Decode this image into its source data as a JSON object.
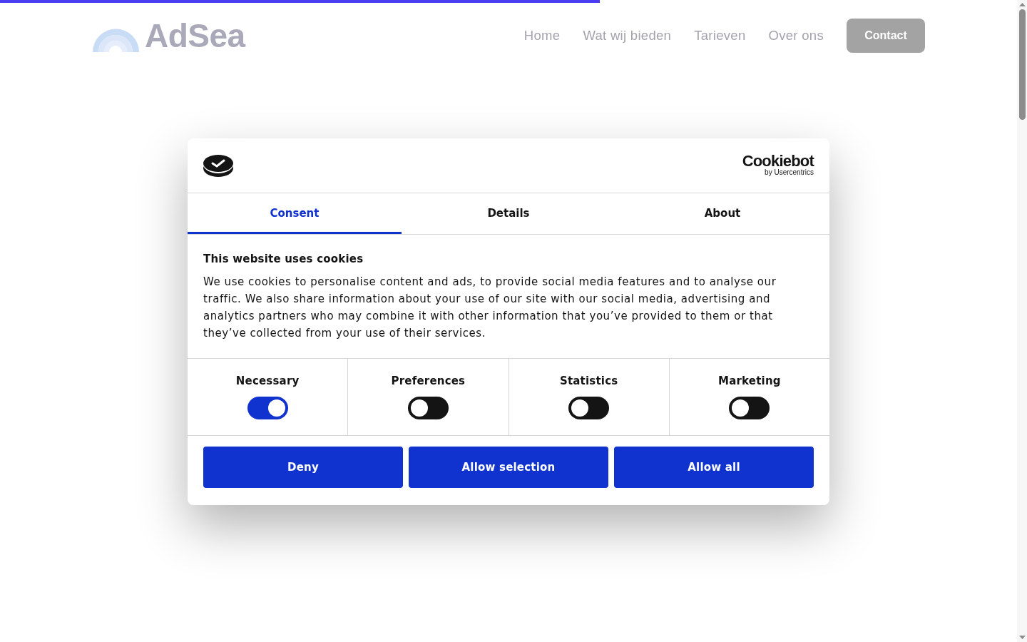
{
  "progress_bar": {
    "level": 0.59
  },
  "header": {
    "logo": {
      "text": "AdSea"
    },
    "nav": [
      "Home",
      "Wat wij bieden",
      "Tarieven",
      "Over ons"
    ],
    "cta": "Contact"
  },
  "dialog": {
    "brand": {
      "name": "Cookiebot",
      "tagline": "by Usercentrics"
    },
    "tabs": [
      {
        "label": "Consent",
        "selected": true
      },
      {
        "label": "Details",
        "selected": false
      },
      {
        "label": "About",
        "selected": false
      }
    ],
    "title": "This website uses cookies",
    "body": "We use cookies to personalise content and ads, to provide social media features and to analyse our traffic. We also share information about your use of our site with our social media, advertising and analytics partners who may combine it with other information that you’ve provided to them or that they’ve collected from your use of their services.",
    "categories": [
      {
        "label": "Necessary",
        "on": true
      },
      {
        "label": "Preferences",
        "on": false
      },
      {
        "label": "Statistics",
        "on": false
      },
      {
        "label": "Marketing",
        "on": false
      }
    ],
    "buttons": [
      "Deny",
      "Allow selection",
      "Allow all"
    ]
  }
}
